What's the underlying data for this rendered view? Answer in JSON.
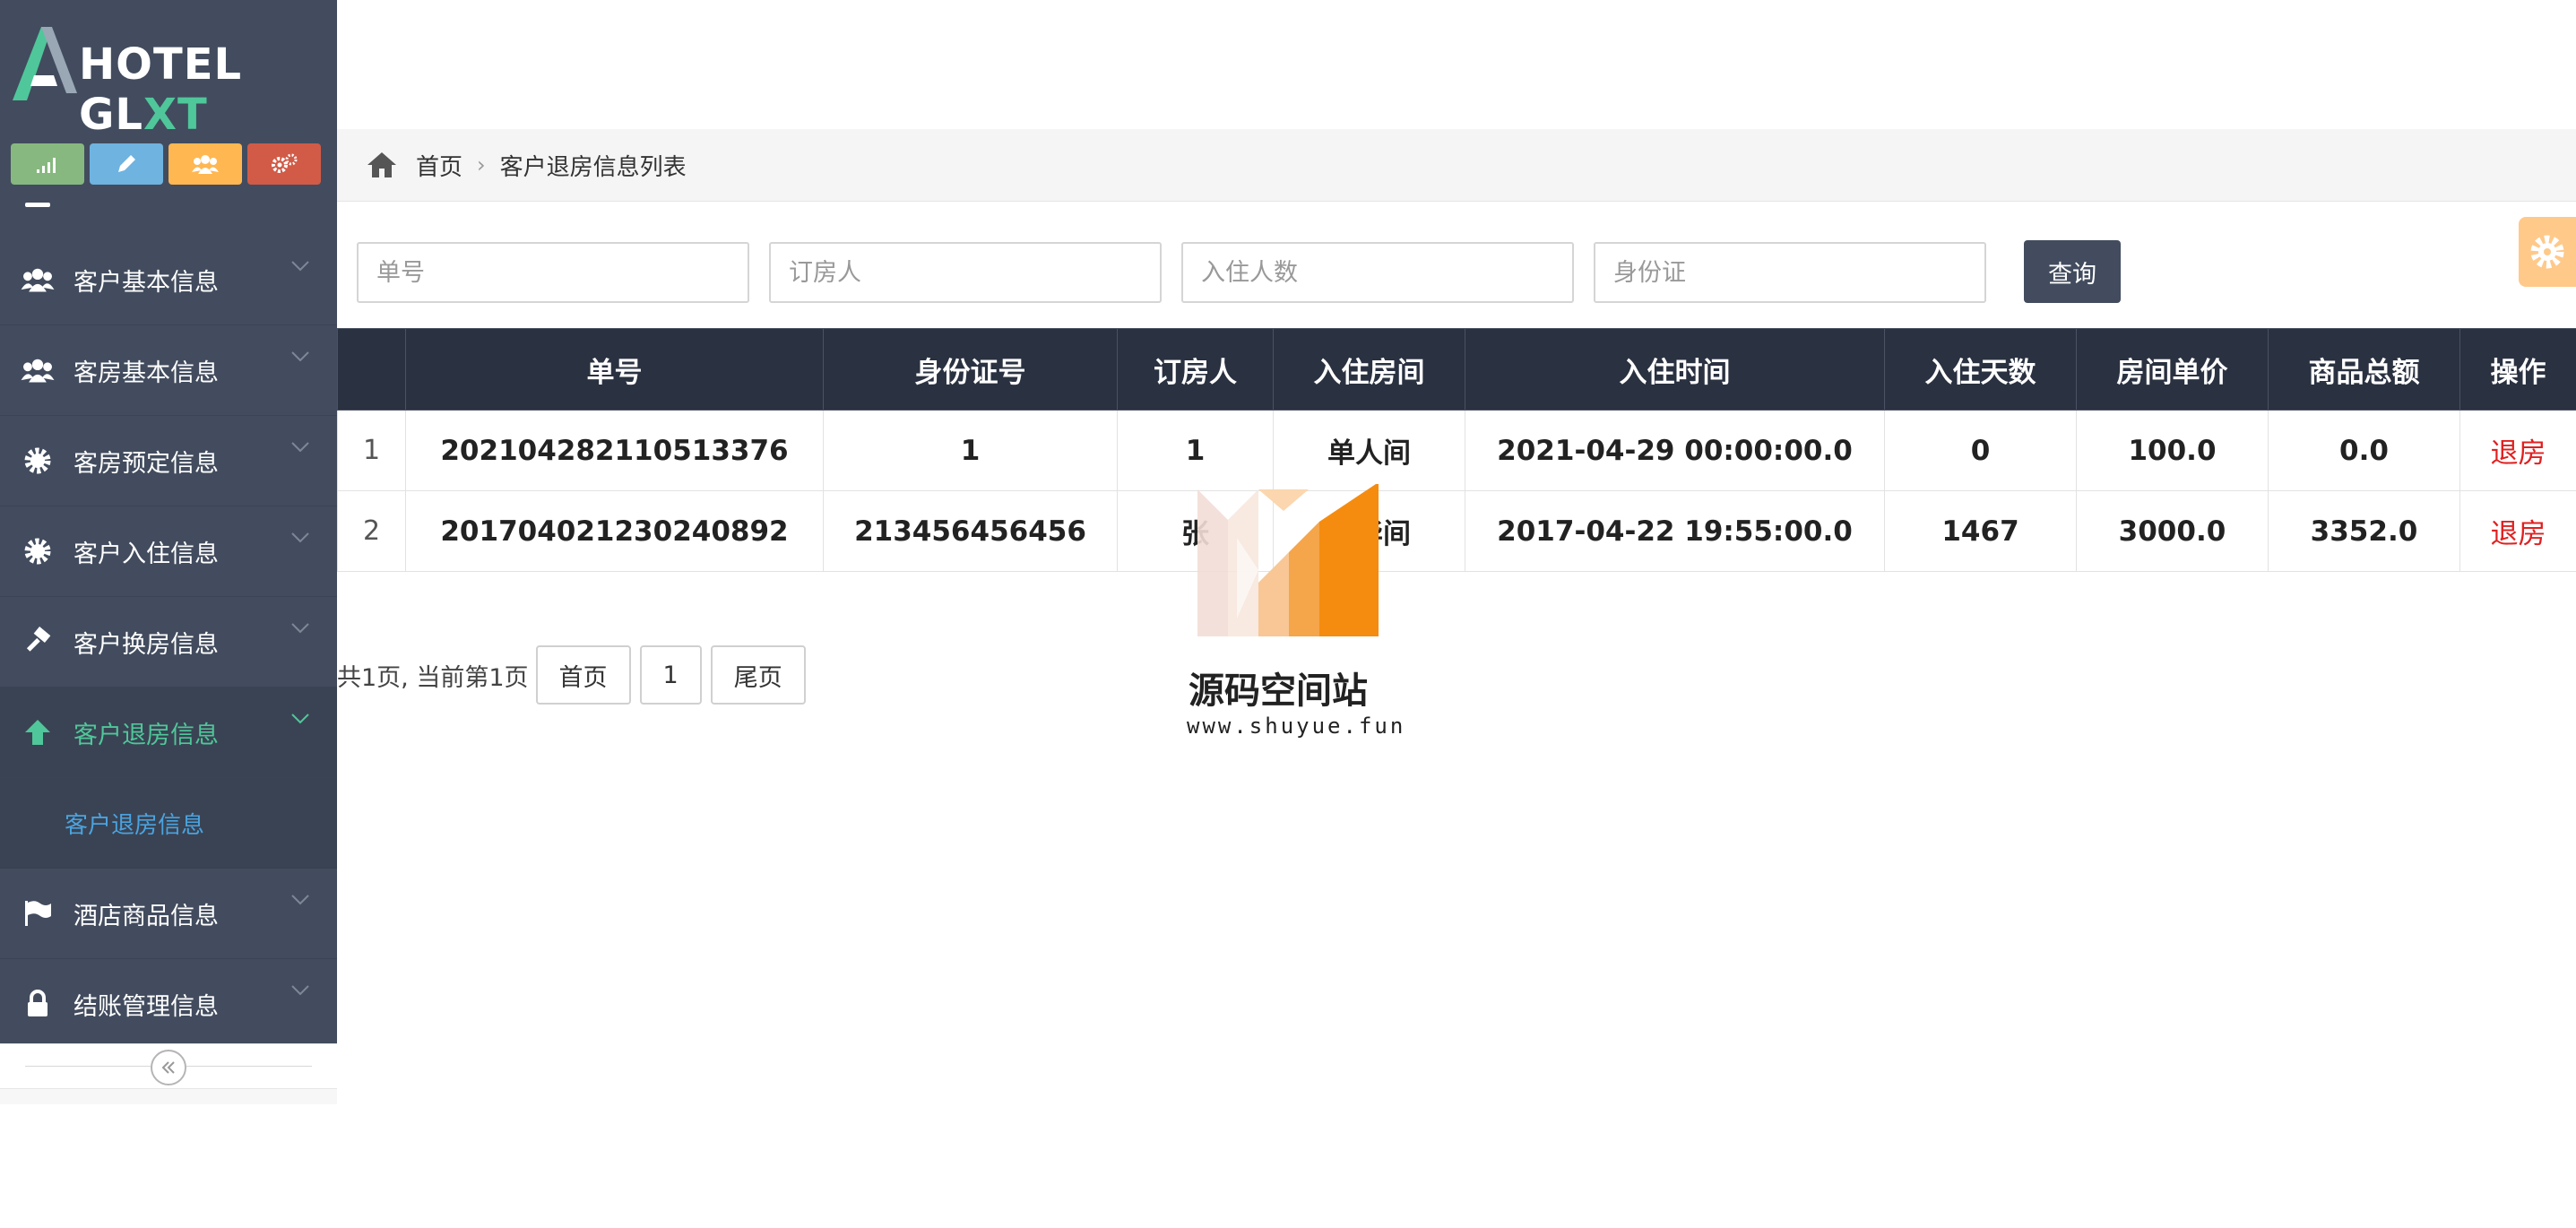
{
  "brand": {
    "name_main": "HOTEL GL",
    "name_accent": "XT",
    "accent_color": "#4fc79a"
  },
  "shortcuts": [
    {
      "icon": "signal-icon",
      "color": "#87b87f"
    },
    {
      "icon": "pencil-icon",
      "color": "#6fb3e0"
    },
    {
      "icon": "users-icon",
      "color": "#ffb752"
    },
    {
      "icon": "cogs-icon",
      "color": "#d15b47"
    }
  ],
  "sidebar": {
    "items": [
      {
        "label": "客户基本信息",
        "icon": "users-icon"
      },
      {
        "label": "客房基本信息",
        "icon": "users-icon"
      },
      {
        "label": "客房预定信息",
        "icon": "cog-icon"
      },
      {
        "label": "客户入住信息",
        "icon": "cog-icon"
      },
      {
        "label": "客户换房信息",
        "icon": "gavel-icon"
      },
      {
        "label": "客户退房信息",
        "icon": "arrow-up-icon",
        "active": true
      },
      {
        "label": "酒店商品信息",
        "icon": "flag-icon"
      },
      {
        "label": "结账管理信息",
        "icon": "lock-icon"
      }
    ],
    "active_sub": "客户退房信息"
  },
  "breadcrumb": {
    "home": "首页",
    "current": "客户退房信息列表"
  },
  "search": {
    "order_no_placeholder": "单号",
    "booker_placeholder": "订房人",
    "guests_placeholder": "入住人数",
    "id_card_placeholder": "身份证",
    "query_label": "查询"
  },
  "table": {
    "headers": {
      "order_no": "单号",
      "id_card": "身份证号",
      "booker": "订房人",
      "room": "入住房间",
      "checkin": "入住时间",
      "days": "入住天数",
      "price": "房间单价",
      "goods": "商品总额",
      "op": "操作"
    },
    "rows": [
      {
        "idx": "1",
        "order_no": "202104282110513376",
        "id_card": "1",
        "booker": "1",
        "room": "单人间",
        "checkin": "2021-04-29 00:00:00.0",
        "days": "0",
        "price": "100.0",
        "goods": "0.0",
        "op": "退房"
      },
      {
        "idx": "2",
        "order_no": "201704021230240892",
        "id_card": "213456456456",
        "booker": "张",
        "room": "豪华间",
        "checkin": "2017-04-22 19:55:00.0",
        "days": "1467",
        "price": "3000.0",
        "goods": "3352.0",
        "op": "退房"
      }
    ]
  },
  "pager": {
    "info": "共1页, 当前第1页",
    "first": "首页",
    "page": "1",
    "last": "尾页"
  },
  "watermark": {
    "title": "源码空间站",
    "url": "www.shuyue.fun"
  }
}
